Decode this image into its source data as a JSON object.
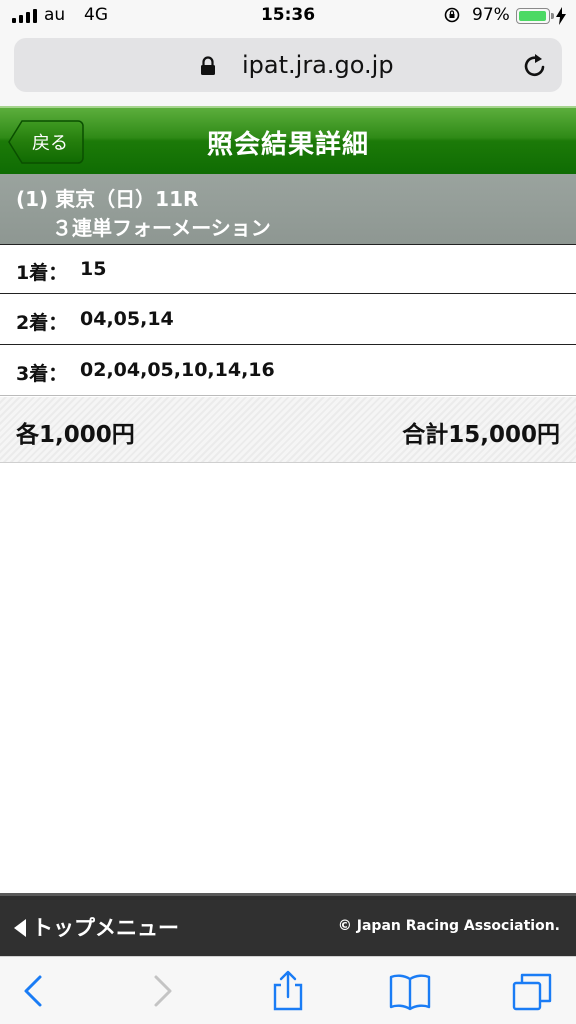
{
  "status_bar": {
    "carrier": "au",
    "network": "4G",
    "time": "15:36",
    "battery_percent": "97%",
    "battery_level": 0.97,
    "signal_bars": 4
  },
  "browser": {
    "url": "ipat.jra.go.jp"
  },
  "header": {
    "back_label": "戻る",
    "title": "照会結果詳細"
  },
  "race": {
    "line1": "(1) 東京（日）11R",
    "line2": "３連単フォーメーション"
  },
  "places": [
    {
      "label": "1着：",
      "numbers": "15"
    },
    {
      "label": "2着：",
      "numbers": "04,05,14"
    },
    {
      "label": "3着：",
      "numbers": "02,04,05,10,14,16"
    }
  ],
  "amount": {
    "each": "各1,000円",
    "total": "合計15,000円"
  },
  "footer": {
    "menu_label": "トップメニュー",
    "copyright": "© Japan Racing Association."
  },
  "toolbar": {
    "icons": [
      "back-icon",
      "forward-icon",
      "share-icon",
      "bookmarks-icon",
      "tabs-icon"
    ]
  },
  "colors": {
    "header_green": "#1c7a08",
    "race_bar_gray": "#8e9792",
    "footer_dark": "#303030",
    "ios_blue": "#1a7cf5"
  }
}
